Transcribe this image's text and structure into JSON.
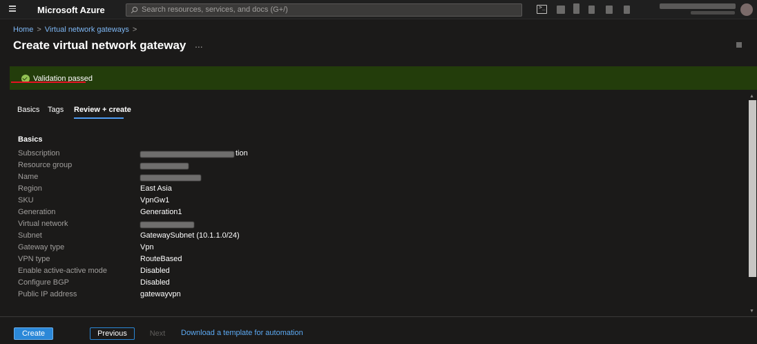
{
  "topbar": {
    "menu_icon": "hamburger-icon",
    "brand": "Microsoft Azure",
    "search_placeholder": "Search resources, services, and docs (G+/)",
    "search_icon": "search-icon",
    "cloud_shell_icon": "cloud-shell-icon"
  },
  "breadcrumb": {
    "items": [
      "Home",
      "Virtual network gateways"
    ],
    "separator": ">"
  },
  "page": {
    "title": "Create virtual network gateway",
    "more": "..."
  },
  "banner": {
    "text": "Validation passed",
    "icon": "check-circle-icon",
    "color": "#233d0b"
  },
  "tabs": [
    {
      "label": "Basics"
    },
    {
      "label": "Tags"
    },
    {
      "label": "Review + create",
      "active": true
    }
  ],
  "summary": {
    "section": "Basics",
    "rows": [
      {
        "label": "Subscription",
        "value": "tion",
        "redacted": true
      },
      {
        "label": "Resource group",
        "value": "",
        "redacted": true
      },
      {
        "label": "Name",
        "value": "",
        "redacted": true
      },
      {
        "label": "Region",
        "value": "East Asia"
      },
      {
        "label": "SKU",
        "value": "VpnGw1"
      },
      {
        "label": "Generation",
        "value": "Generation1"
      },
      {
        "label": "Virtual network",
        "value": "",
        "redacted": true
      },
      {
        "label": "Subnet",
        "value": "GatewaySubnet (10.1.1.0/24)"
      },
      {
        "label": "Gateway type",
        "value": "Vpn"
      },
      {
        "label": "VPN type",
        "value": "RouteBased"
      },
      {
        "label": "Enable active-active mode",
        "value": "Disabled"
      },
      {
        "label": "Configure BGP",
        "value": "Disabled"
      },
      {
        "label": "Public IP address",
        "value": "gatewayvpn"
      }
    ]
  },
  "footer": {
    "create": "Create",
    "previous": "Previous",
    "next": "Next",
    "download_link": "Download a template for automation"
  },
  "colors": {
    "accent": "#2b88d8",
    "link": "#5ca9f2",
    "success": "#92c353"
  }
}
